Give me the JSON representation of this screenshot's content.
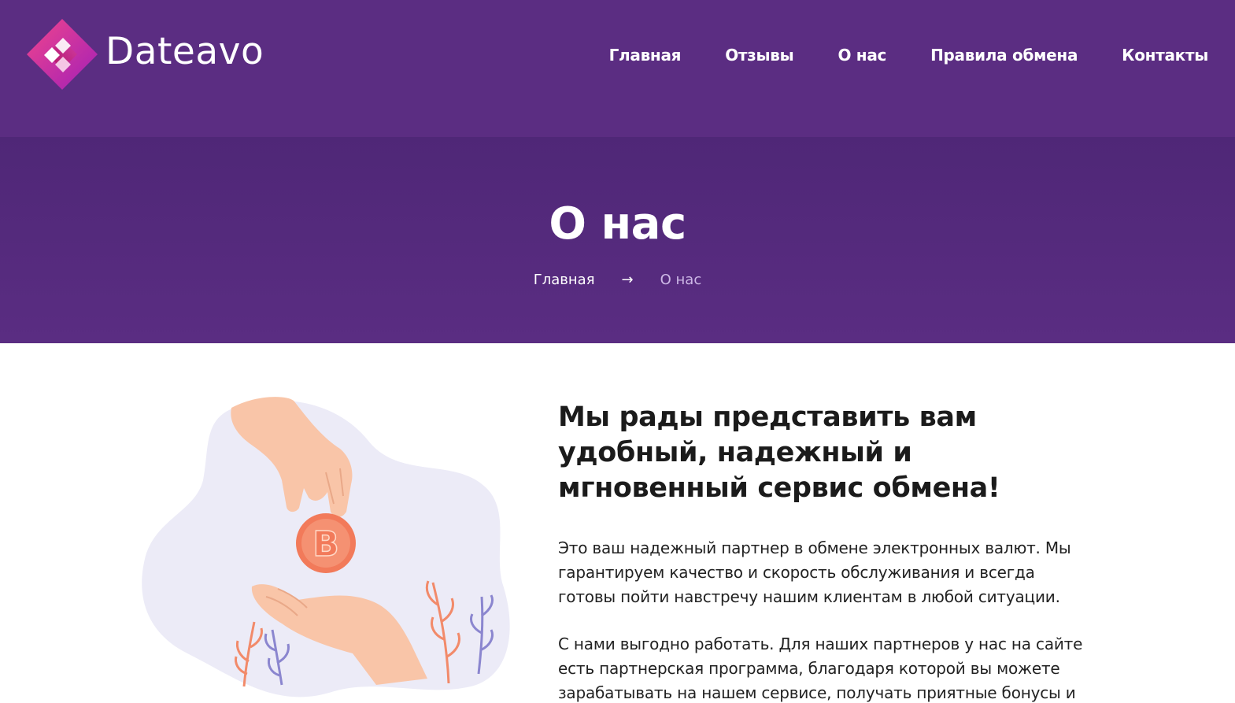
{
  "header": {
    "logo_text": "Dateavo",
    "nav": [
      {
        "label": "Главная"
      },
      {
        "label": "Отзывы"
      },
      {
        "label": "О нас"
      },
      {
        "label": "Правила обмена"
      },
      {
        "label": "Контакты"
      }
    ]
  },
  "hero": {
    "title": "О нас",
    "breadcrumb": {
      "home": "Главная",
      "separator": "→",
      "current": "О нас"
    }
  },
  "content": {
    "title": "Мы рады представить вам удобный, надежный и мгновенный сервис обмена!",
    "paragraphs": [
      "Это ваш надежный партнер в обмене электронных валют. Мы гарантируем качество и скорость обслуживания и всегда готовы пойти навстречу нашим клиентам в любой ситуации.",
      "С нами выгодно работать. Для наших партнеров у нас на сайте есть партнерская программа, благодаря которой вы можете зарабатывать на нашем сервисе, получать приятные бонусы и"
    ]
  },
  "illustration": {
    "coin_icon": "bitcoin-icon"
  },
  "colors": {
    "header_bg": "#5b2d82",
    "hero_bg": "#4f2777",
    "logo_gradient_start": "#e83e8c",
    "logo_gradient_end": "#9b1fb5",
    "coin": "#f27a5a",
    "blob": "#ecebf7"
  }
}
